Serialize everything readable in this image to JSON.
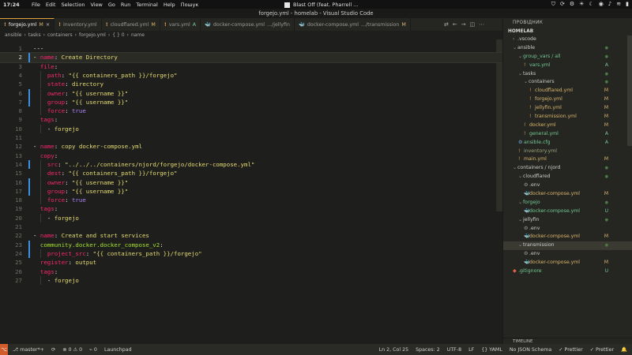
{
  "os_bar": {
    "clock": "17:24",
    "menu": [
      "File",
      "Edit",
      "Selection",
      "View",
      "Go",
      "Run",
      "Terminal",
      "Help",
      "Пошук"
    ],
    "media_title": "Blast Off (feat. Pharrell ...",
    "tray_icons": [
      "shield-icon",
      "sync-icon",
      "settings-icon",
      "sun-icon",
      "moon-icon",
      "droplet-icon",
      "volume-icon",
      "wifi-icon",
      "battery-icon"
    ]
  },
  "window": {
    "title": "forgejo.yml - homelab - Visual Studio Code"
  },
  "tabs": [
    {
      "label": "forgejo.yml",
      "status": "M",
      "icon": "!",
      "active": true
    },
    {
      "label": "inventory.yml",
      "status": "",
      "icon": "!",
      "active": false
    },
    {
      "label": "cloudflared.yml",
      "status": "M",
      "icon": "!",
      "active": false
    },
    {
      "label": "vars.yml",
      "status": "A",
      "icon": "!",
      "active": false
    },
    {
      "label": "docker-compose.yml",
      "suffix": ".../jellyfin",
      "status": "",
      "icon": "docker",
      "active": false
    },
    {
      "label": "docker-compose.yml",
      "suffix": ".../transmission",
      "status": "M",
      "icon": "docker",
      "active": false
    }
  ],
  "breadcrumb": [
    "ansible",
    "tasks",
    "containers",
    "forgejo.yml",
    "{ } 0",
    "name"
  ],
  "editor": {
    "current_line": 2,
    "lines": [
      {
        "n": "1",
        "g": "",
        "t": [
          [
            "p",
            "---"
          ]
        ]
      },
      {
        "n": "2",
        "g": "mod",
        "t": [
          [
            "p",
            "- "
          ],
          [
            "k",
            "name"
          ],
          [
            "p",
            ": "
          ],
          [
            "s",
            "Create Directory"
          ]
        ]
      },
      {
        "n": "3",
        "g": "",
        "t": [
          [
            "p",
            "  "
          ],
          [
            "k",
            "file"
          ],
          [
            "p",
            ":"
          ]
        ]
      },
      {
        "n": "4",
        "g": "",
        "t": [
          [
            "p",
            "    "
          ],
          [
            "k",
            "path"
          ],
          [
            "p",
            ": "
          ],
          [
            "s",
            "\"{{ containers_path }}/forgejo\""
          ]
        ]
      },
      {
        "n": "5",
        "g": "",
        "t": [
          [
            "p",
            "    "
          ],
          [
            "k",
            "state"
          ],
          [
            "p",
            ": "
          ],
          [
            "s",
            "directory"
          ]
        ]
      },
      {
        "n": "6",
        "g": "mod",
        "t": [
          [
            "p",
            "    "
          ],
          [
            "k",
            "owner"
          ],
          [
            "p",
            ": "
          ],
          [
            "s",
            "\"{{ username }}\""
          ]
        ]
      },
      {
        "n": "7",
        "g": "mod",
        "t": [
          [
            "p",
            "    "
          ],
          [
            "k",
            "group"
          ],
          [
            "p",
            ": "
          ],
          [
            "s",
            "\"{{ username }}\""
          ]
        ]
      },
      {
        "n": "8",
        "g": "",
        "t": [
          [
            "p",
            "    "
          ],
          [
            "k",
            "force"
          ],
          [
            "p",
            ": "
          ],
          [
            "b",
            "true"
          ]
        ]
      },
      {
        "n": "9",
        "g": "",
        "t": [
          [
            "p",
            "  "
          ],
          [
            "k",
            "tags"
          ],
          [
            "p",
            ":"
          ]
        ]
      },
      {
        "n": "10",
        "g": "",
        "t": [
          [
            "p",
            "    - "
          ],
          [
            "s",
            "forgejo"
          ]
        ]
      },
      {
        "n": "11",
        "g": "",
        "t": []
      },
      {
        "n": "12",
        "g": "",
        "t": [
          [
            "p",
            "- "
          ],
          [
            "k",
            "name"
          ],
          [
            "p",
            ": "
          ],
          [
            "s",
            "copy docker-compose.yml"
          ]
        ]
      },
      {
        "n": "13",
        "g": "",
        "t": [
          [
            "p",
            "  "
          ],
          [
            "k",
            "copy"
          ],
          [
            "p",
            ":"
          ]
        ]
      },
      {
        "n": "14",
        "g": "mod",
        "t": [
          [
            "p",
            "    "
          ],
          [
            "k",
            "src"
          ],
          [
            "p",
            ": "
          ],
          [
            "s",
            "\"../../../containers/njord/forgejo/docker-compose.yml\""
          ]
        ]
      },
      {
        "n": "15",
        "g": "",
        "t": [
          [
            "p",
            "    "
          ],
          [
            "k",
            "dest"
          ],
          [
            "p",
            ": "
          ],
          [
            "s",
            "\"{{ containers_path }}/forgejo\""
          ]
        ]
      },
      {
        "n": "16",
        "g": "mod",
        "t": [
          [
            "p",
            "    "
          ],
          [
            "k",
            "owner"
          ],
          [
            "p",
            ": "
          ],
          [
            "s",
            "\"{{ username }}\""
          ]
        ]
      },
      {
        "n": "17",
        "g": "mod",
        "t": [
          [
            "p",
            "    "
          ],
          [
            "k",
            "group"
          ],
          [
            "p",
            ": "
          ],
          [
            "s",
            "\"{{ username }}\""
          ]
        ]
      },
      {
        "n": "18",
        "g": "",
        "t": [
          [
            "p",
            "    "
          ],
          [
            "k",
            "force"
          ],
          [
            "p",
            ": "
          ],
          [
            "b",
            "true"
          ]
        ]
      },
      {
        "n": "19",
        "g": "",
        "t": [
          [
            "p",
            "  "
          ],
          [
            "k",
            "tags"
          ],
          [
            "p",
            ":"
          ]
        ]
      },
      {
        "n": "20",
        "g": "",
        "t": [
          [
            "p",
            "    - "
          ],
          [
            "s",
            "forgejo"
          ]
        ]
      },
      {
        "n": "21",
        "g": "",
        "t": []
      },
      {
        "n": "22",
        "g": "",
        "t": [
          [
            "p",
            "- "
          ],
          [
            "k",
            "name"
          ],
          [
            "p",
            ": "
          ],
          [
            "s",
            "Create and start services"
          ]
        ]
      },
      {
        "n": "23",
        "g": "mod",
        "t": [
          [
            "p",
            "  "
          ],
          [
            "c",
            "community.docker.docker_compose_v2"
          ],
          [
            "p",
            ":"
          ]
        ]
      },
      {
        "n": "24",
        "g": "mod",
        "t": [
          [
            "p",
            "    "
          ],
          [
            "k",
            "project_src"
          ],
          [
            "p",
            ": "
          ],
          [
            "s",
            "\"{{ containers_path }}/forgejo\""
          ]
        ]
      },
      {
        "n": "25",
        "g": "",
        "t": [
          [
            "p",
            "  "
          ],
          [
            "k",
            "register"
          ],
          [
            "p",
            ": "
          ],
          [
            "s",
            "output"
          ]
        ]
      },
      {
        "n": "26",
        "g": "",
        "t": [
          [
            "p",
            "  "
          ],
          [
            "k",
            "tags"
          ],
          [
            "p",
            ":"
          ]
        ]
      },
      {
        "n": "27",
        "g": "",
        "t": [
          [
            "p",
            "    - "
          ],
          [
            "s",
            "forgejo"
          ]
        ]
      }
    ]
  },
  "explorer": {
    "header": "ПРОВІДНИК",
    "root": "HOMELAB",
    "items": [
      {
        "depth": 0,
        "kind": "folder",
        "open": false,
        "name": ".vscode",
        "badge": "",
        "tone": ""
      },
      {
        "depth": 0,
        "kind": "folder",
        "open": true,
        "name": "ansible",
        "badge": "dot",
        "tone": ""
      },
      {
        "depth": 1,
        "kind": "folder",
        "open": true,
        "name": "group_vars / all",
        "badge": "dot",
        "tone": "add"
      },
      {
        "depth": 2,
        "kind": "yml",
        "name": "vars.yml",
        "badge": "A",
        "tone": "add"
      },
      {
        "depth": 1,
        "kind": "folder",
        "open": true,
        "name": "tasks",
        "badge": "dot",
        "tone": ""
      },
      {
        "depth": 2,
        "kind": "folder",
        "open": true,
        "name": "containers",
        "badge": "dot",
        "tone": ""
      },
      {
        "depth": 3,
        "kind": "yml",
        "name": "cloudflared.yml",
        "badge": "M",
        "tone": "mod"
      },
      {
        "depth": 3,
        "kind": "yml",
        "name": "forgejo.yml",
        "badge": "M",
        "tone": "mod"
      },
      {
        "depth": 3,
        "kind": "yml",
        "name": "jellyfin.yml",
        "badge": "M",
        "tone": "mod"
      },
      {
        "depth": 3,
        "kind": "yml",
        "name": "transmission.yml",
        "badge": "M",
        "tone": "mod"
      },
      {
        "depth": 2,
        "kind": "yml",
        "name": "docker.yml",
        "badge": "M",
        "tone": "mod"
      },
      {
        "depth": 2,
        "kind": "yml",
        "name": "general.yml",
        "badge": "A",
        "tone": "add"
      },
      {
        "depth": 1,
        "kind": "cfg",
        "name": "ansible.cfg",
        "badge": "A",
        "tone": "add"
      },
      {
        "depth": 1,
        "kind": "yml",
        "name": "inventory.yml",
        "badge": "",
        "tone": "mute"
      },
      {
        "depth": 1,
        "kind": "yml",
        "name": "main.yml",
        "badge": "M",
        "tone": "mod"
      },
      {
        "depth": 0,
        "kind": "folder",
        "open": true,
        "name": "containers / njord",
        "badge": "dot",
        "tone": ""
      },
      {
        "depth": 1,
        "kind": "folder",
        "open": true,
        "name": "cloudflared",
        "badge": "dot",
        "tone": ""
      },
      {
        "depth": 2,
        "kind": "env",
        "name": ".env",
        "badge": "",
        "tone": ""
      },
      {
        "depth": 2,
        "kind": "dk",
        "name": "docker-compose.yml",
        "badge": "M",
        "tone": "mod"
      },
      {
        "depth": 1,
        "kind": "folder",
        "open": true,
        "name": "forgejo",
        "badge": "dot",
        "tone": "add"
      },
      {
        "depth": 2,
        "kind": "dk",
        "name": "docker-compose.yml",
        "badge": "U",
        "tone": "add"
      },
      {
        "depth": 1,
        "kind": "folder",
        "open": true,
        "name": "jellyfin",
        "badge": "dot",
        "tone": ""
      },
      {
        "depth": 2,
        "kind": "env",
        "name": ".env",
        "badge": "",
        "tone": ""
      },
      {
        "depth": 2,
        "kind": "dk",
        "name": "docker-compose.yml",
        "badge": "M",
        "tone": "mod"
      },
      {
        "depth": 1,
        "kind": "folder",
        "open": true,
        "name": "transmission",
        "badge": "dot",
        "tone": "",
        "selected": true
      },
      {
        "depth": 2,
        "kind": "env",
        "name": ".env",
        "badge": "",
        "tone": ""
      },
      {
        "depth": 2,
        "kind": "dk",
        "name": "docker-compose.yml",
        "badge": "M",
        "tone": "mod"
      },
      {
        "depth": 0,
        "kind": "git",
        "name": ".gitignore",
        "badge": "U",
        "tone": "add"
      }
    ],
    "timeline": "TIMELINE"
  },
  "status_bar": {
    "branch": "master*+",
    "sync": "⟳",
    "problems": "⊗ 0 ⚠ 0",
    "ports": "⌁ 0",
    "launchpad": "Launchpad",
    "cursor": "Ln 2, Col 25",
    "spaces": "Spaces: 2",
    "encoding": "UTF-8",
    "eol": "LF",
    "language": "{} YAML",
    "schema": "No JSON Schema",
    "prettier1": "✓ Prettier",
    "prettier2": "✓ Prettier"
  },
  "colors": {
    "accent": "#d25d2b",
    "modified": "#d9b56c",
    "added": "#73c991",
    "keyword": "#f92672",
    "string": "#e6db74"
  }
}
